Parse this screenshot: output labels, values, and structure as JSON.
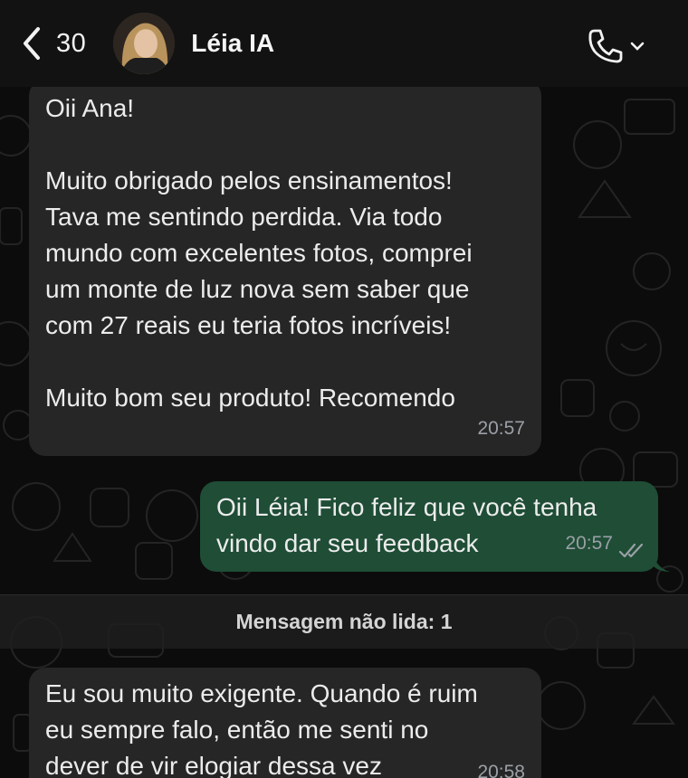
{
  "header": {
    "back_count": "30",
    "contact_name": "Léia IA"
  },
  "messages": [
    {
      "direction": "incoming",
      "lines": [
        "Oii Ana!",
        "",
        "Muito obrigado pelos ensinamentos!",
        "Tava me sentindo perdida. Via todo",
        "mundo com excelentes fotos, comprei",
        "um monte de luz nova sem saber que",
        "com 27 reais eu teria fotos incríveis!",
        "",
        "Muito bom seu produto! Recomendo"
      ],
      "time": "20:57"
    },
    {
      "direction": "outgoing",
      "lines": [
        "Oii Léia! Fico feliz que você tenha",
        "vindo dar seu feedback"
      ],
      "time": "20:57",
      "status": "read-double-check"
    },
    {
      "direction": "incoming",
      "lines": [
        "Eu sou muito exigente. Quando é ruim",
        "eu sempre falo, então me senti no",
        "dever de vir elogiar dessa vez"
      ],
      "time": "20:58"
    }
  ],
  "unread_divider": "Mensagem não lida: 1",
  "colors": {
    "background": "#0c0c0c",
    "header": "#121212",
    "incoming_bubble": "#262626",
    "outgoing_bubble": "#1f4d36",
    "timestamp": "#9aa0a6",
    "read_ticks": "#9aa0a6"
  },
  "icons": [
    "chevron-left-icon",
    "phone-icon",
    "chevron-down-icon",
    "double-check-icon"
  ]
}
